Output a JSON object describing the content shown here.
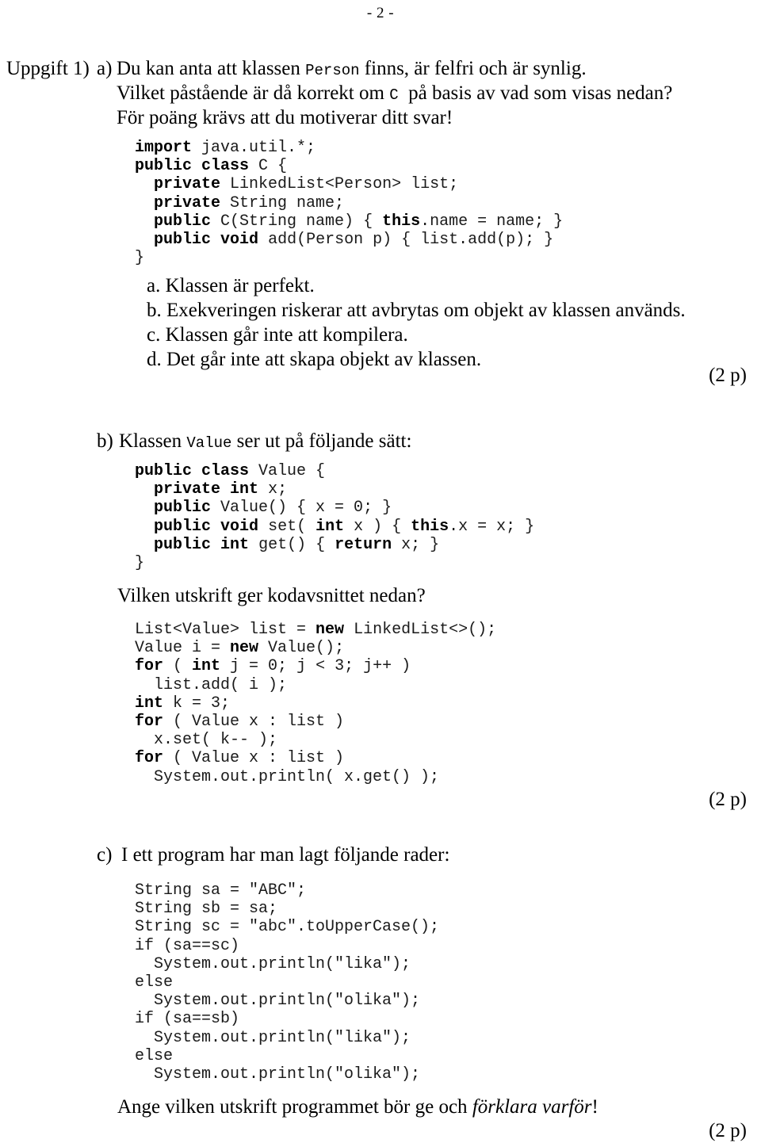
{
  "page": {
    "number_label": "- 2 -"
  },
  "task": {
    "label": "Uppgift 1)",
    "parts": [
      {
        "marker": "a)",
        "lines": [
          {
            "pre": "Du kan anta att klassen ",
            "mono": "Person",
            "post": " finns, är felfri och är synlig."
          },
          {
            "pre": "Vilket påstående är då korrekt om ",
            "mono": "C",
            "post": "  på basis av vad som visas nedan?"
          },
          {
            "pre": "För poäng krävs att du motiverar ditt svar!",
            "mono": "",
            "post": ""
          }
        ],
        "code": "import java.util.*;\npublic class C {\n  private LinkedList<Person> list;\n  private String name;\n  public C(String name) { this.name = name; }\n  public void add(Person p) { list.add(p); }\n}",
        "options": [
          "a. Klassen är perfekt.",
          "b. Exekveringen riskerar att avbrytas om objekt av klassen används.",
          "c. Klassen går inte att kompilera.",
          "d. Det går inte att skapa objekt av klassen."
        ],
        "points": "(2 p)"
      },
      {
        "marker": "b)",
        "heading": {
          "pre": "Klassen ",
          "mono": "Value",
          "post": " ser ut på följande sätt:"
        },
        "code1": "public class Value {\n  private int x;\n  public Value() { x = 0; }\n  public void set( int x ) { this.x = x; }\n  public int get() { return x; }\n}",
        "question": "Vilken utskrift ger kodavsnittet nedan?",
        "code2": "List<Value> list = new LinkedList<>();\nValue i = new Value();\nfor ( int j = 0; j < 3; j++ )\n  list.add( i );\nint k = 3;\nfor ( Value x : list )\n  x.set( k-- );\nfor ( Value x : list )\n  System.out.println( x.get() );",
        "points": "(2 p)"
      },
      {
        "marker": "c)",
        "heading": {
          "pre": "I ett program har man lagt följande rader:",
          "mono": "",
          "post": ""
        },
        "code": "String sa = \"ABC\";\nString sb = sa;\nString sc = \"abc\".toUpperCase();\nif (sa==sc)\n  System.out.println(\"lika\");\nelse\n  System.out.println(\"olika\");\nif (sa==sb)\n  System.out.println(\"lika\");\nelse\n  System.out.println(\"olika\");",
        "closing": {
          "pre": "Ange vilken utskrift programmet bör ge och ",
          "italic": "förklara varför",
          "post": "!"
        },
        "points": "(2 p)"
      }
    ]
  }
}
